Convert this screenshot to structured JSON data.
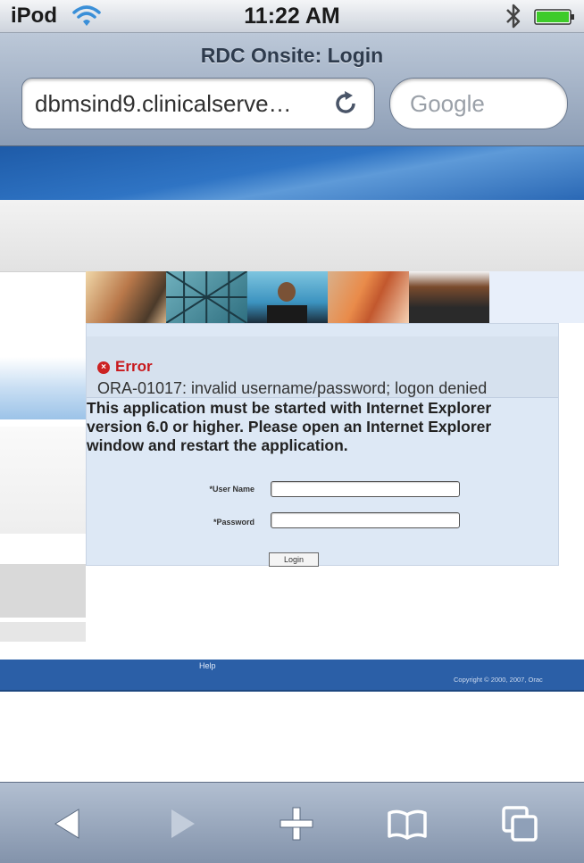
{
  "status_bar": {
    "carrier": "iPod",
    "time": "11:22 AM"
  },
  "browser": {
    "page_title": "RDC Onsite: Login",
    "url": "dbmsind9.clinicalserve…",
    "search_placeholder": "Google"
  },
  "login_page": {
    "error": {
      "title": "Error",
      "message": "ORA-01017: invalid username/password; logon denied"
    },
    "browser_notice": "This application must be started with Internet Explorer version 6.0 or higher. Please open an Internet Explorer window and restart the application.",
    "username_label": "*User Name",
    "password_label": "*Password",
    "username_value": "",
    "password_value": "",
    "login_button": "Login"
  },
  "footer": {
    "help_link": "Help",
    "copyright": "Copyright © 2000, 2007, Orac"
  },
  "toolbar": {
    "icons": [
      "back-icon",
      "forward-icon",
      "add-bookmark-icon",
      "bookmarks-icon",
      "pages-icon"
    ]
  },
  "colors": {
    "banner_blue": "#2f74c4",
    "error_red": "#c8181c",
    "panel_blue": "#dde8f5",
    "footer_blue": "#2b5fa7"
  }
}
